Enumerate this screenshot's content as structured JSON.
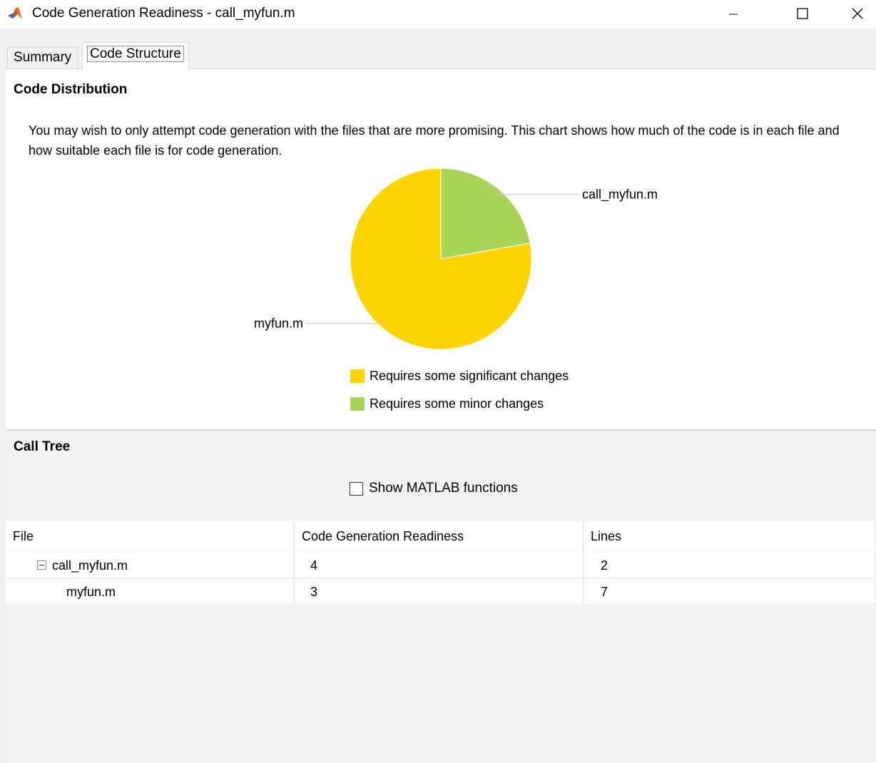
{
  "window": {
    "title": "Code Generation Readiness - call_myfun.m",
    "app_icon": "matlab-icon",
    "controls": [
      "minimize-icon",
      "maximize-icon",
      "close-icon"
    ]
  },
  "tabs": [
    {
      "label": "Summary",
      "selected": false
    },
    {
      "label": "Code Structure",
      "selected": true
    }
  ],
  "code_distribution": {
    "title": "Code Distribution",
    "description": "You may wish to only attempt code generation with the files that are more promising. This chart shows how much of the code is in each file and how suitable each file is for code generation."
  },
  "chart_data": {
    "type": "pie",
    "slices": [
      {
        "label": "call_myfun.m",
        "value": 2,
        "color": "#a8d45a"
      },
      {
        "label": "myfun.m",
        "value": 7,
        "color": "#fdd300"
      }
    ],
    "legend": [
      {
        "label": "Requires some significant changes",
        "color": "#fdd300"
      },
      {
        "label": "Requires some minor changes",
        "color": "#a8d45a"
      }
    ]
  },
  "call_tree": {
    "title": "Call Tree",
    "show_matlab_functions_label": "Show MATLAB functions",
    "show_matlab_functions_checked": false,
    "columns": [
      "File",
      "Code Generation Readiness",
      "Lines"
    ],
    "rows": [
      {
        "file": "call_myfun.m",
        "readiness": "4",
        "lines": "2",
        "expanded": true,
        "level": 0
      },
      {
        "file": "myfun.m",
        "readiness": "3",
        "lines": "7",
        "level": 1
      }
    ]
  }
}
